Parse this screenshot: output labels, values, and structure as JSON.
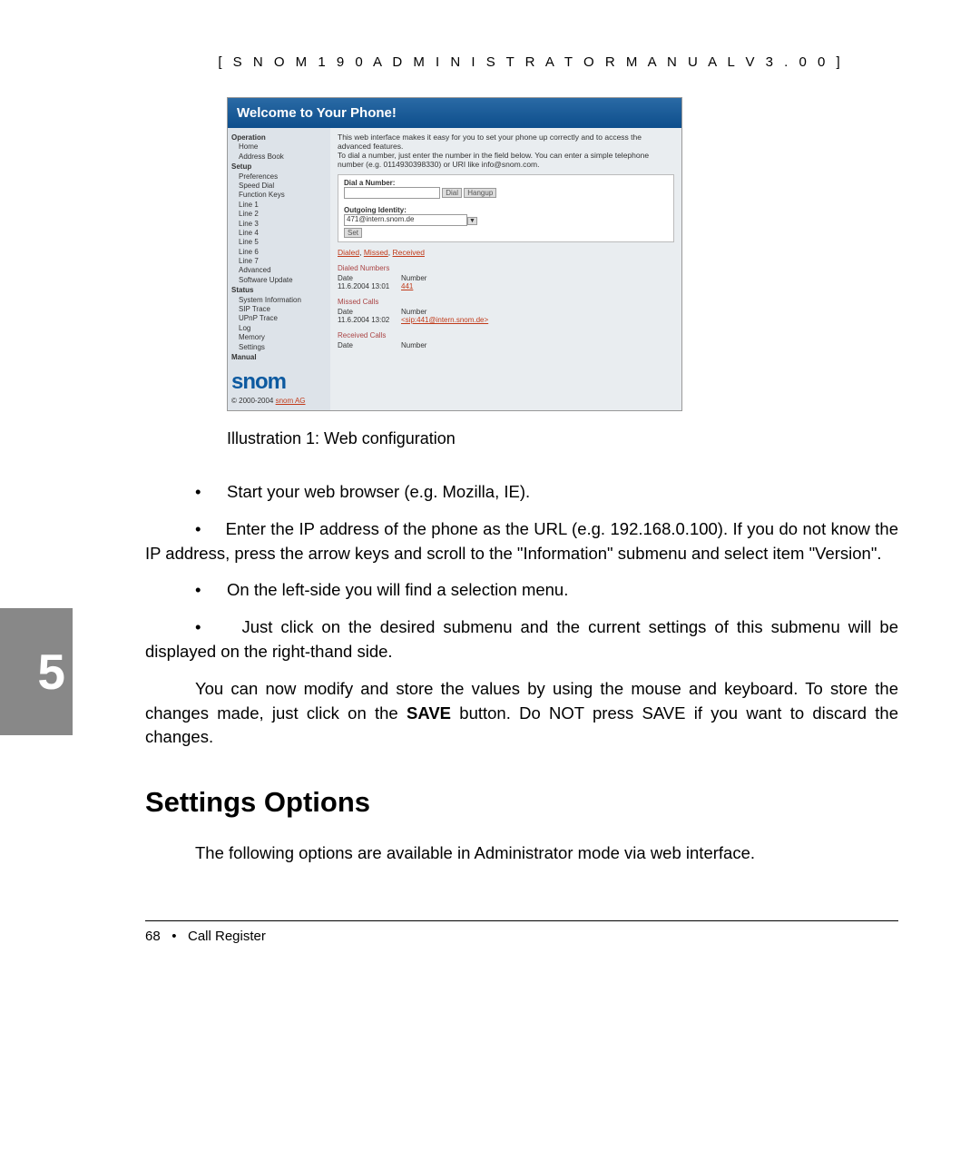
{
  "header": "[  S N O M   1 9 0   A D M I N I S T R A T O R   M A N U A L   V 3 . 0 0  ]",
  "chapter_number": "5",
  "screenshot": {
    "title": "Welcome to Your Phone!",
    "sidebar": {
      "groups": [
        {
          "heading": "Operation",
          "items": [
            "Home",
            "Address Book"
          ]
        },
        {
          "heading": "Setup",
          "items": [
            "Preferences",
            "Speed Dial",
            "Function Keys",
            "Line 1",
            "Line 2",
            "Line 3",
            "Line 4",
            "Line 5",
            "Line 6",
            "Line 7",
            "Advanced",
            "Software Update"
          ]
        },
        {
          "heading": "Status",
          "items": [
            "System Information",
            "SIP Trace",
            "UPnP Trace",
            "Log",
            "Memory",
            "Settings"
          ]
        },
        {
          "heading": "Manual",
          "items": []
        }
      ],
      "logo_text": "snom",
      "copyright": "© 2000-2004 ",
      "copyright_link": "snom AG"
    },
    "intro1": "This web interface makes it easy for you to set your phone up correctly and to access the advanced features.",
    "intro2": "To dial a number, just enter the number in the field below. You can enter a simple telephone number (e.g. 0114930398330) or URI like info@snom.com.",
    "dial_label": "Dial a Number:",
    "dial_btn": "Dial",
    "hangup_btn": "Hangup",
    "identity_label": "Outgoing Identity:",
    "identity_value": "471@intern.snom.de",
    "set_btn": "Set",
    "links": {
      "dialed": "Dialed",
      "missed": "Missed",
      "received": "Received"
    },
    "dialed": {
      "heading": "Dialed Numbers",
      "date_h": "Date",
      "num_h": "Number",
      "date": "11.6.2004 13:01",
      "number": "441"
    },
    "missed": {
      "heading": "Missed Calls",
      "date_h": "Date",
      "num_h": "Number",
      "date": "11.6.2004 13:02",
      "number": "<sip:441@intern.snom.de>"
    },
    "received": {
      "heading": "Received Calls",
      "date_h": "Date",
      "num_h": "Number"
    }
  },
  "caption": "Illustration 1: Web configuration",
  "bullets": {
    "b1": "Start your web browser (e.g. Mozilla, IE).",
    "b2a": "Enter the IP address of the phone as the URL (e.g. ",
    "b2b": "192.168.0.100). If you do not know the IP address, press the arrow keys and scroll to the \"Information\" submenu and select item \"Version\".",
    "b3": "On the left-side you will find a selection menu.",
    "b4a": "Just click on the desired submenu and the current settings ",
    "b4b": "of this submenu will be displayed on the right-thand side."
  },
  "para1a": "You can now modify and store the values by using the mouse and keyboard. To store the changes made, just click on the ",
  "para1b": "SAVE",
  "para1c": " button. Do NOT press SAVE if you want to discard the changes.",
  "h2": "Settings Options",
  "para2": "The following options are available in Administrator mode via web interface.",
  "footer": {
    "page": "68",
    "sep": "•",
    "section": "Call Register"
  }
}
